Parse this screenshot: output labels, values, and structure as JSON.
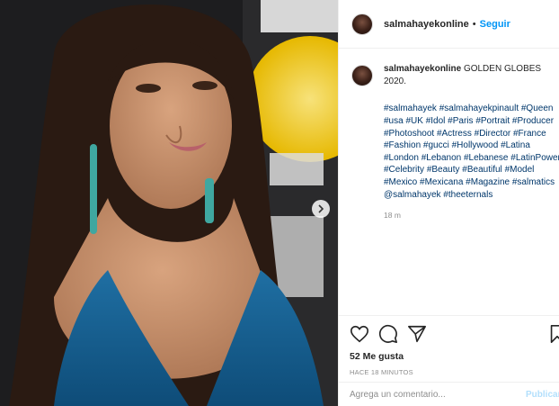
{
  "post": {
    "username": "salmahayekonline",
    "separator": "•",
    "follow_label": "Seguir",
    "caption_text": "GOLDEN GLOBES 2020.",
    "hashtags": [
      "#salmahayek",
      "#salmahayekpinault",
      "#Queen",
      "#usa",
      "#UK",
      "#Idol",
      "#Paris",
      "#Portrait",
      "#Producer",
      "#Photoshoot",
      "#Actress",
      "#Director",
      "#France",
      "#Fashion",
      "#gucci",
      "#Hollywood",
      "#Latina",
      "#London",
      "#Lebanon",
      "#Lebanese",
      "#LatinPower",
      "#Celebrity",
      "#Beauty",
      "#Beautiful",
      "#Model",
      "#Mexico",
      "#Mexicana",
      "#Magazine",
      "#salmatics",
      "@salmahayek",
      "#theeternals"
    ],
    "caption_age": "18 m",
    "likes_label": "52 Me gusta",
    "posted_ago": "HACE 18 MINUTOS",
    "comment_placeholder": "Agrega un comentario...",
    "publish_label": "Publicar"
  },
  "icons": {
    "like": "heart-icon",
    "comment": "comment-icon",
    "share": "paper-plane-icon",
    "save": "bookmark-icon",
    "next": "chevron-right-icon"
  },
  "colors": {
    "link": "#00376b",
    "follow": "#0095f6",
    "publish_disabled": "#b2dffc",
    "muted": "#8e8e8e"
  }
}
